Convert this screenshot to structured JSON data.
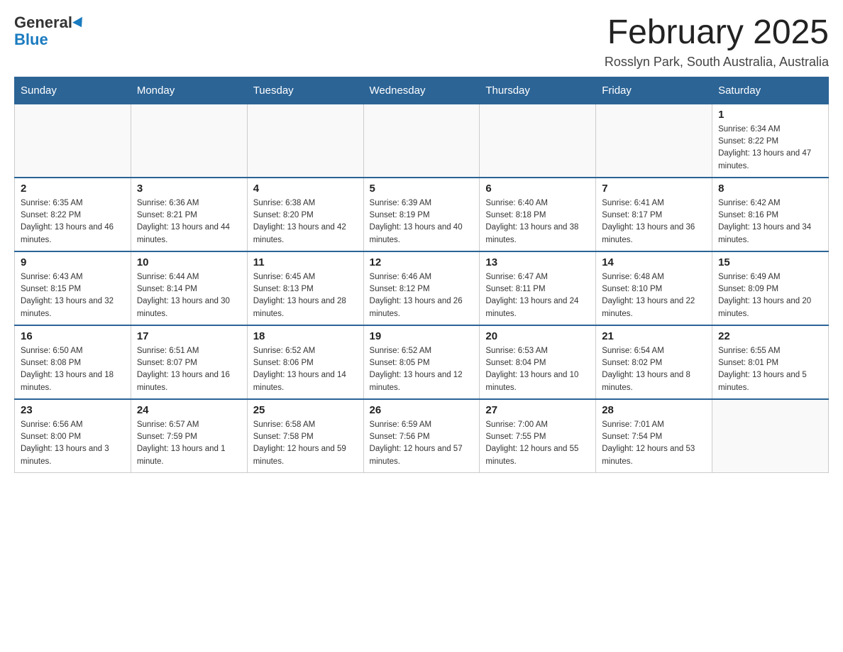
{
  "header": {
    "logo_general": "General",
    "logo_blue": "Blue",
    "month_title": "February 2025",
    "location": "Rosslyn Park, South Australia, Australia"
  },
  "days_of_week": [
    "Sunday",
    "Monday",
    "Tuesday",
    "Wednesday",
    "Thursday",
    "Friday",
    "Saturday"
  ],
  "weeks": [
    [
      {
        "day": "",
        "info": ""
      },
      {
        "day": "",
        "info": ""
      },
      {
        "day": "",
        "info": ""
      },
      {
        "day": "",
        "info": ""
      },
      {
        "day": "",
        "info": ""
      },
      {
        "day": "",
        "info": ""
      },
      {
        "day": "1",
        "info": "Sunrise: 6:34 AM\nSunset: 8:22 PM\nDaylight: 13 hours and 47 minutes."
      }
    ],
    [
      {
        "day": "2",
        "info": "Sunrise: 6:35 AM\nSunset: 8:22 PM\nDaylight: 13 hours and 46 minutes."
      },
      {
        "day": "3",
        "info": "Sunrise: 6:36 AM\nSunset: 8:21 PM\nDaylight: 13 hours and 44 minutes."
      },
      {
        "day": "4",
        "info": "Sunrise: 6:38 AM\nSunset: 8:20 PM\nDaylight: 13 hours and 42 minutes."
      },
      {
        "day": "5",
        "info": "Sunrise: 6:39 AM\nSunset: 8:19 PM\nDaylight: 13 hours and 40 minutes."
      },
      {
        "day": "6",
        "info": "Sunrise: 6:40 AM\nSunset: 8:18 PM\nDaylight: 13 hours and 38 minutes."
      },
      {
        "day": "7",
        "info": "Sunrise: 6:41 AM\nSunset: 8:17 PM\nDaylight: 13 hours and 36 minutes."
      },
      {
        "day": "8",
        "info": "Sunrise: 6:42 AM\nSunset: 8:16 PM\nDaylight: 13 hours and 34 minutes."
      }
    ],
    [
      {
        "day": "9",
        "info": "Sunrise: 6:43 AM\nSunset: 8:15 PM\nDaylight: 13 hours and 32 minutes."
      },
      {
        "day": "10",
        "info": "Sunrise: 6:44 AM\nSunset: 8:14 PM\nDaylight: 13 hours and 30 minutes."
      },
      {
        "day": "11",
        "info": "Sunrise: 6:45 AM\nSunset: 8:13 PM\nDaylight: 13 hours and 28 minutes."
      },
      {
        "day": "12",
        "info": "Sunrise: 6:46 AM\nSunset: 8:12 PM\nDaylight: 13 hours and 26 minutes."
      },
      {
        "day": "13",
        "info": "Sunrise: 6:47 AM\nSunset: 8:11 PM\nDaylight: 13 hours and 24 minutes."
      },
      {
        "day": "14",
        "info": "Sunrise: 6:48 AM\nSunset: 8:10 PM\nDaylight: 13 hours and 22 minutes."
      },
      {
        "day": "15",
        "info": "Sunrise: 6:49 AM\nSunset: 8:09 PM\nDaylight: 13 hours and 20 minutes."
      }
    ],
    [
      {
        "day": "16",
        "info": "Sunrise: 6:50 AM\nSunset: 8:08 PM\nDaylight: 13 hours and 18 minutes."
      },
      {
        "day": "17",
        "info": "Sunrise: 6:51 AM\nSunset: 8:07 PM\nDaylight: 13 hours and 16 minutes."
      },
      {
        "day": "18",
        "info": "Sunrise: 6:52 AM\nSunset: 8:06 PM\nDaylight: 13 hours and 14 minutes."
      },
      {
        "day": "19",
        "info": "Sunrise: 6:52 AM\nSunset: 8:05 PM\nDaylight: 13 hours and 12 minutes."
      },
      {
        "day": "20",
        "info": "Sunrise: 6:53 AM\nSunset: 8:04 PM\nDaylight: 13 hours and 10 minutes."
      },
      {
        "day": "21",
        "info": "Sunrise: 6:54 AM\nSunset: 8:02 PM\nDaylight: 13 hours and 8 minutes."
      },
      {
        "day": "22",
        "info": "Sunrise: 6:55 AM\nSunset: 8:01 PM\nDaylight: 13 hours and 5 minutes."
      }
    ],
    [
      {
        "day": "23",
        "info": "Sunrise: 6:56 AM\nSunset: 8:00 PM\nDaylight: 13 hours and 3 minutes."
      },
      {
        "day": "24",
        "info": "Sunrise: 6:57 AM\nSunset: 7:59 PM\nDaylight: 13 hours and 1 minute."
      },
      {
        "day": "25",
        "info": "Sunrise: 6:58 AM\nSunset: 7:58 PM\nDaylight: 12 hours and 59 minutes."
      },
      {
        "day": "26",
        "info": "Sunrise: 6:59 AM\nSunset: 7:56 PM\nDaylight: 12 hours and 57 minutes."
      },
      {
        "day": "27",
        "info": "Sunrise: 7:00 AM\nSunset: 7:55 PM\nDaylight: 12 hours and 55 minutes."
      },
      {
        "day": "28",
        "info": "Sunrise: 7:01 AM\nSunset: 7:54 PM\nDaylight: 12 hours and 53 minutes."
      },
      {
        "day": "",
        "info": ""
      }
    ]
  ]
}
